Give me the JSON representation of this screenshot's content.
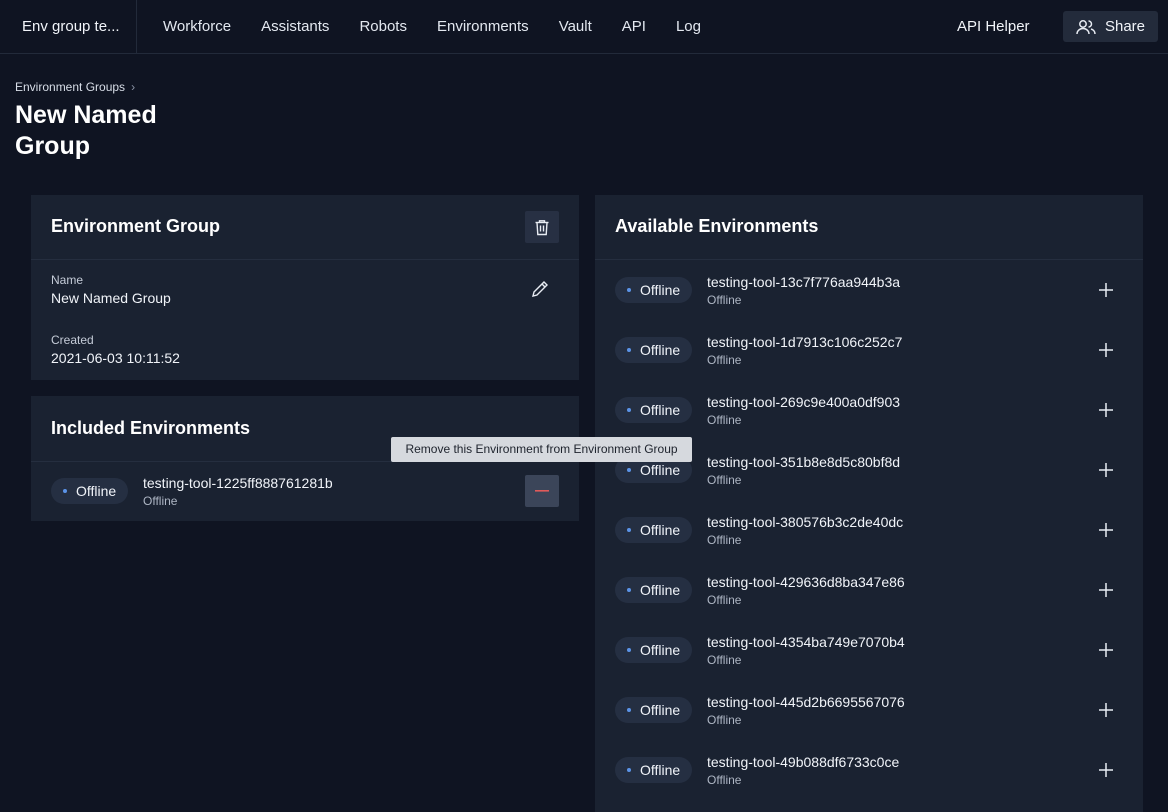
{
  "nav": {
    "workspace": "Env group te...",
    "items": [
      "Workforce",
      "Assistants",
      "Robots",
      "Environments",
      "Vault",
      "API",
      "Log"
    ],
    "api_helper": "API Helper",
    "share": "Share"
  },
  "header": {
    "breadcrumb": "Environment Groups",
    "title": "New Named Group"
  },
  "group_panel": {
    "title": "Environment Group",
    "name_label": "Name",
    "name_value": "New Named Group",
    "created_label": "Created",
    "created_value": "2021-06-03 10:11:52"
  },
  "included": {
    "title": "Included Environments",
    "tooltip": "Remove this Environment from Environment Group",
    "items": [
      {
        "status": "Offline",
        "name": "testing-tool-1225ff888761281b",
        "sub": "Offline"
      }
    ]
  },
  "available": {
    "title": "Available Environments",
    "items": [
      {
        "status": "Offline",
        "name": "testing-tool-13c7f776aa944b3a",
        "sub": "Offline"
      },
      {
        "status": "Offline",
        "name": "testing-tool-1d7913c106c252c7",
        "sub": "Offline"
      },
      {
        "status": "Offline",
        "name": "testing-tool-269c9e400a0df903",
        "sub": "Offline"
      },
      {
        "status": "Offline",
        "name": "testing-tool-351b8e8d5c80bf8d",
        "sub": "Offline"
      },
      {
        "status": "Offline",
        "name": "testing-tool-380576b3c2de40dc",
        "sub": "Offline"
      },
      {
        "status": "Offline",
        "name": "testing-tool-429636d8ba347e86",
        "sub": "Offline"
      },
      {
        "status": "Offline",
        "name": "testing-tool-4354ba749e7070b4",
        "sub": "Offline"
      },
      {
        "status": "Offline",
        "name": "testing-tool-445d2b6695567076",
        "sub": "Offline"
      },
      {
        "status": "Offline",
        "name": "testing-tool-49b088df6733c0ce",
        "sub": "Offline"
      }
    ]
  },
  "colors": {
    "background": "#0f1422",
    "panel": "#1a2231",
    "status_dot": "#5b93e8",
    "remove_accent": "#e05a5a"
  }
}
